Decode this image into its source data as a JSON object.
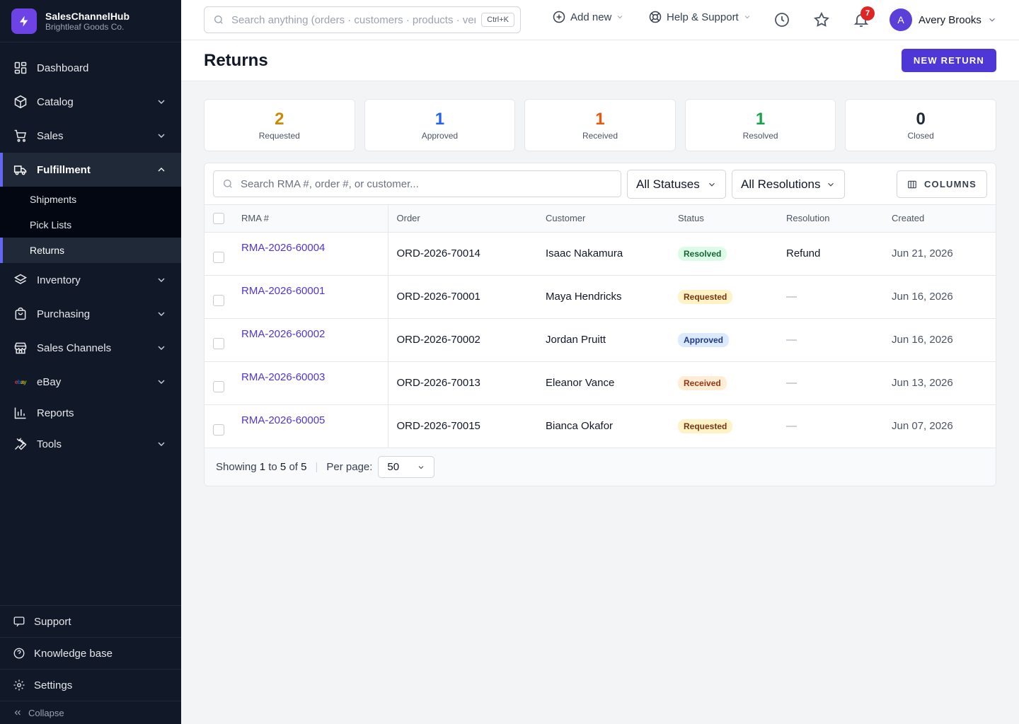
{
  "brand": {
    "name": "SalesChannelHub",
    "sub": "Brightleaf Goods Co."
  },
  "sidebar": {
    "items": [
      {
        "label": "Dashboard",
        "icon": "dashboard-icon"
      },
      {
        "label": "Catalog",
        "icon": "box-icon"
      },
      {
        "label": "Sales",
        "icon": "cart-icon"
      },
      {
        "label": "Fulfillment",
        "icon": "truck-icon"
      },
      {
        "label": "Inventory",
        "icon": "layers-icon"
      },
      {
        "label": "Purchasing",
        "icon": "bag-icon"
      },
      {
        "label": "Sales Channels",
        "icon": "store-icon"
      },
      {
        "label": "eBay",
        "icon": "ebay-icon"
      },
      {
        "label": "Reports",
        "icon": "chart-icon"
      },
      {
        "label": "Tools",
        "icon": "wrench-icon"
      }
    ],
    "sub_items": [
      {
        "label": "Shipments"
      },
      {
        "label": "Pick Lists"
      },
      {
        "label": "Returns"
      }
    ],
    "ebay_logo": "ebay",
    "bottom": [
      {
        "label": "Support",
        "icon": "chat-icon"
      },
      {
        "label": "Knowledge base",
        "icon": "help-icon"
      },
      {
        "label": "Settings",
        "icon": "gear-icon"
      }
    ],
    "collapse": "Collapse"
  },
  "topbar": {
    "search_placeholder": "Search anything (orders · customers · products · vendors)",
    "shortcut": "Ctrl+K",
    "add_new": "Add new",
    "help": "Help & Support",
    "notifications_count": "7",
    "user_initial": "A",
    "user_name": "Avery Brooks"
  },
  "page": {
    "title": "Returns",
    "new_button": "NEW RETURN"
  },
  "stats": [
    {
      "value": "2",
      "label": "Requested",
      "color": "#ca8a04"
    },
    {
      "value": "1",
      "label": "Approved",
      "color": "#2563eb"
    },
    {
      "value": "1",
      "label": "Received",
      "color": "#ea580c"
    },
    {
      "value": "1",
      "label": "Resolved",
      "color": "#16a34a"
    },
    {
      "value": "0",
      "label": "Closed",
      "color": "#1f2937"
    }
  ],
  "table": {
    "search_placeholder": "Search RMA #, order #, or customer...",
    "status_filter": "All Statuses",
    "resolution_filter": "All Resolutions",
    "columns_button": "COLUMNS",
    "headers": {
      "rma": "RMA #",
      "order": "Order",
      "customer": "Customer",
      "status": "Status",
      "resolution": "Resolution",
      "created": "Created"
    },
    "rows": [
      {
        "rma": "RMA-2026-60004",
        "order": "ORD-2026-70014",
        "customer": "Isaac Nakamura",
        "status": "Resolved",
        "resolution": "Refund",
        "created": "Jun 21, 2026"
      },
      {
        "rma": "RMA-2026-60001",
        "order": "ORD-2026-70001",
        "customer": "Maya Hendricks",
        "status": "Requested",
        "resolution": "—",
        "created": "Jun 16, 2026"
      },
      {
        "rma": "RMA-2026-60002",
        "order": "ORD-2026-70002",
        "customer": "Jordan Pruitt",
        "status": "Approved",
        "resolution": "—",
        "created": "Jun 16, 2026"
      },
      {
        "rma": "RMA-2026-60003",
        "order": "ORD-2026-70013",
        "customer": "Eleanor Vance",
        "status": "Received",
        "resolution": "—",
        "created": "Jun 13, 2026"
      },
      {
        "rma": "RMA-2026-60005",
        "order": "ORD-2026-70015",
        "customer": "Bianca Okafor",
        "status": "Requested",
        "resolution": "—",
        "created": "Jun 07, 2026"
      }
    ],
    "status_colors": {
      "Resolved": {
        "bg": "#dcfce7",
        "fg": "#166534"
      },
      "Requested": {
        "bg": "#fef3c7",
        "fg": "#78350f"
      },
      "Approved": {
        "bg": "#dbeafe",
        "fg": "#1e3a8a"
      },
      "Received": {
        "bg": "#ffedd5",
        "fg": "#9a3412"
      }
    }
  },
  "footer": {
    "showing": "Showing",
    "from": "1",
    "to_word": "to",
    "to": "5",
    "of_word": "of",
    "total": "5",
    "per_page_label": "Per page:",
    "per_page_value": "50"
  }
}
